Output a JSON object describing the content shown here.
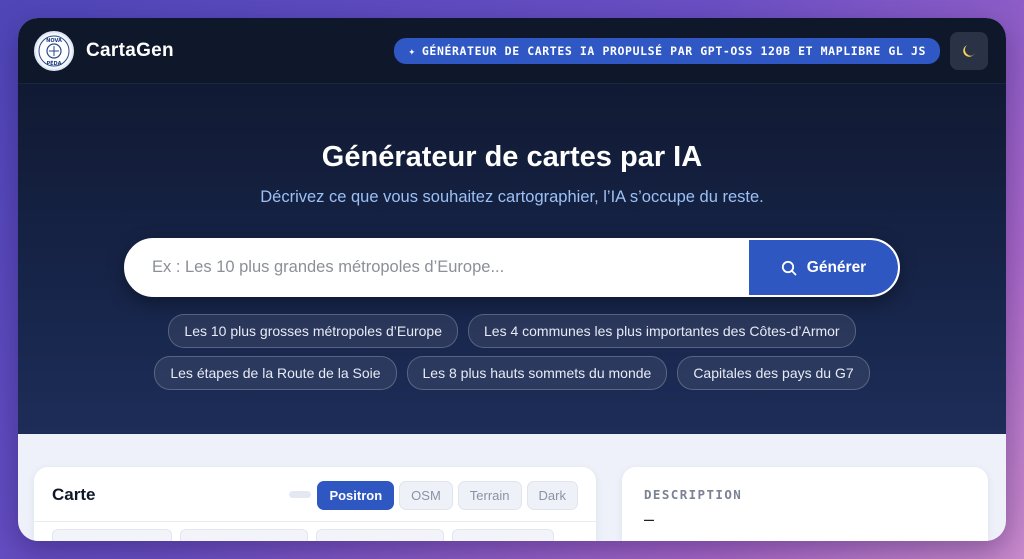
{
  "header": {
    "logo_text_top": "NOVA",
    "logo_text_bottom": "PÉDA",
    "app_name": "CartaGen",
    "badge_icon": "✦",
    "badge_text": "GÉNÉRATEUR DE CARTES IA PROPULSÉ PAR GPT-OSS 120B ET MAPLIBRE GL JS",
    "theme_icon": "moon-icon"
  },
  "hero": {
    "title": "Générateur de cartes par IA",
    "subtitle": "Décrivez ce que vous souhaitez cartographier, l’IA s’occupe du reste.",
    "search_placeholder": "Ex : Les 10 plus grandes métropoles d’Europe...",
    "search_value": "",
    "generate_label": "Générer",
    "suggestions_row1": [
      "Les 10 plus grosses métropoles d’Europe",
      "Les 4 communes les plus importantes des Côtes-d’Armor"
    ],
    "suggestions_row2": [
      "Les étapes de la Route de la Soie",
      "Les 8 plus hauts sommets du monde",
      "Capitales des pays du G7"
    ]
  },
  "map_card": {
    "title": "Carte",
    "tabs": [
      "Positron",
      "OSM",
      "Terrain",
      "Dark"
    ],
    "active_tab": "Positron"
  },
  "description_card": {
    "label": "DESCRIPTION",
    "value": "–"
  },
  "colors": {
    "accent": "#2e57c2",
    "header_bg": "#0f172a",
    "hero_bg": "#17254a"
  }
}
